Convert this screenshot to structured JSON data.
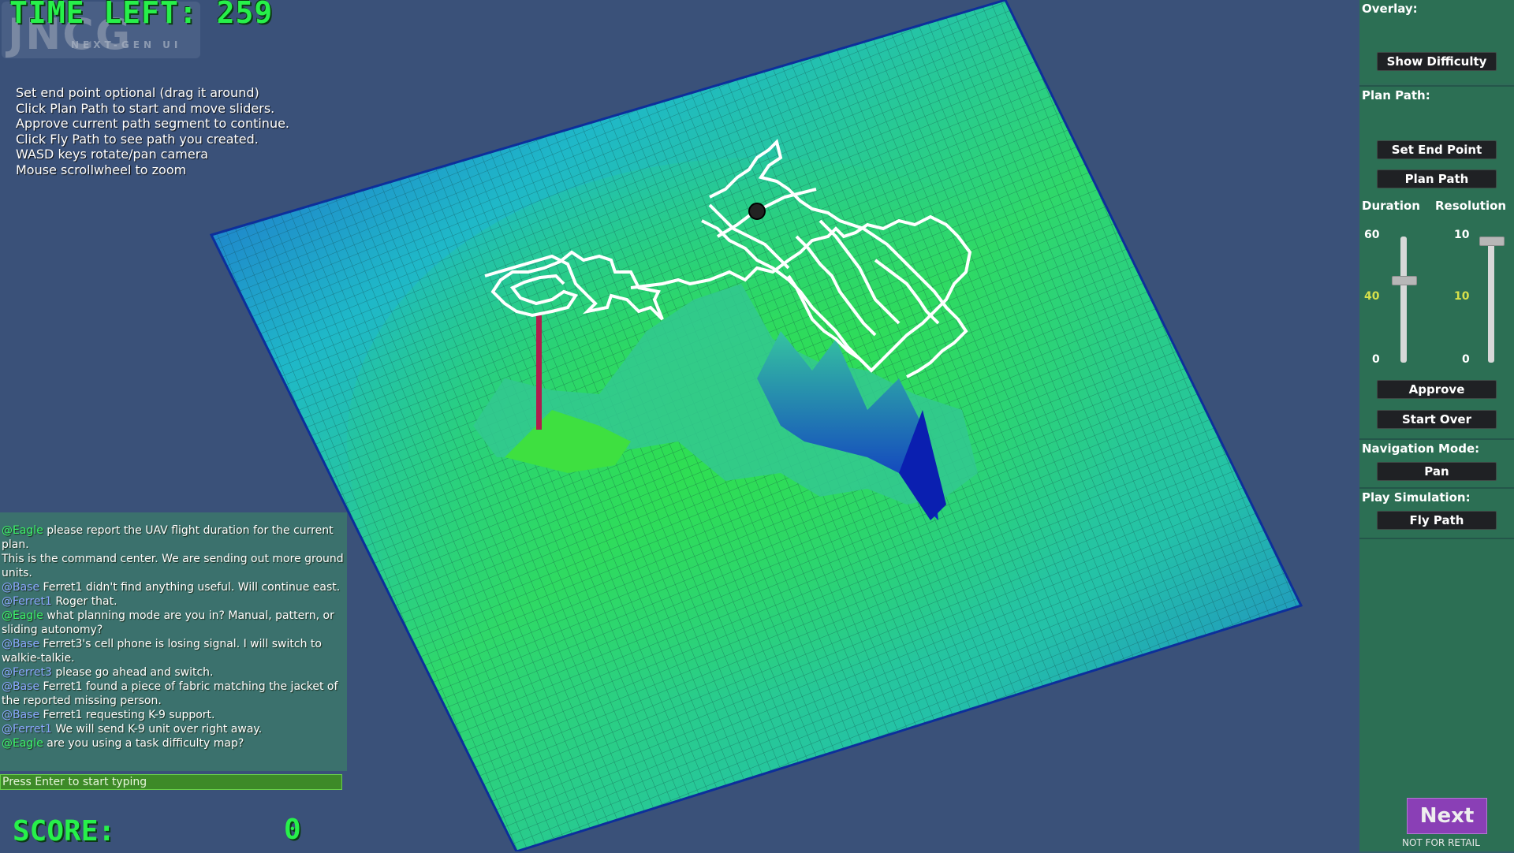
{
  "hud": {
    "time_left": "TIME LEFT: 259",
    "score_label": "SCORE:",
    "score_value": "0"
  },
  "logo": {
    "main": "JNCG",
    "sub": "NEXT-GEN UI"
  },
  "instructions": [
    "Set end point optional (drag it around)",
    "Click Plan Path to start and move sliders.",
    "Approve current path segment to continue.",
    "Click Fly Path to see path you created.",
    "",
    "WASD keys rotate/pan camera",
    "Mouse scrollwheel to zoom"
  ],
  "chat": {
    "messages": [
      {
        "handle": "@Eagle",
        "text": " please report the UAV flight duration for the current plan.",
        "kind": "eagle"
      },
      {
        "handle": "",
        "text": " This is the command center. We are sending out more ground units.",
        "kind": "none"
      },
      {
        "handle": "@Base",
        "text": " Ferret1 didn't find anything useful. Will continue east.",
        "kind": "base"
      },
      {
        "handle": "@Ferret1",
        "text": " Roger that.",
        "kind": "ferret"
      },
      {
        "handle": "@Eagle",
        "text": " what planning mode are you in? Manual, pattern, or sliding autonomy?",
        "kind": "eagle"
      },
      {
        "handle": "@Base",
        "text": " Ferret3's cell phone is losing signal. I will switch to walkie-talkie.",
        "kind": "base"
      },
      {
        "handle": "@Ferret3",
        "text": " please go ahead and switch.",
        "kind": "ferret"
      },
      {
        "handle": "@Base",
        "text": " Ferret1 found a piece of fabric matching the jacket of the reported missing person.",
        "kind": "base"
      },
      {
        "handle": "@Base",
        "text": " Ferret1 requesting K-9 support.",
        "kind": "base"
      },
      {
        "handle": "@Ferret1",
        "text": " We will send K-9 unit over right away.",
        "kind": "ferret"
      },
      {
        "handle": "@Eagle",
        "text": " are you using a task difficulty map?",
        "kind": "eagle"
      }
    ],
    "input_placeholder": "Press Enter to start typing"
  },
  "panel": {
    "overlay_title": "Overlay:",
    "show_difficulty": "Show Difficulty",
    "plan_title": "Plan Path:",
    "set_end_point": "Set End Point",
    "plan_path": "Plan Path",
    "duration_label": "Duration",
    "resolution_label": "Resolution",
    "duration": {
      "max": "60",
      "value": "40",
      "min": "0",
      "fraction": 0.667
    },
    "resolution": {
      "max": "10",
      "value": "10",
      "min": "0",
      "fraction": 1.0
    },
    "approve": "Approve",
    "start_over": "Start Over",
    "nav_title": "Navigation Mode:",
    "nav_mode": "Pan",
    "sim_title": "Play Simulation:",
    "fly_path": "Fly Path"
  },
  "footer": {
    "next": "Next",
    "not_for_retail": "NOT FOR RETAIL"
  },
  "colors": {
    "background": "#3a5179",
    "hud_green": "#27f04a",
    "terrain_low": "#1a5ad8",
    "terrain_high": "#2fd84a",
    "path": "#ffffff",
    "next_button": "#8a3fb6"
  }
}
